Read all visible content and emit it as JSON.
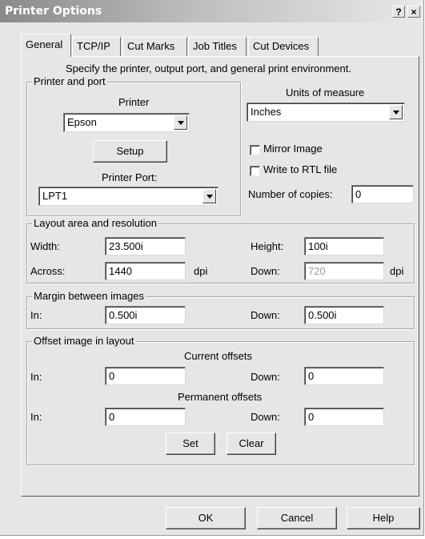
{
  "window": {
    "title": "Printer Options",
    "help_button": "?",
    "close_button": "×"
  },
  "tabs": [
    {
      "label": "General",
      "active": true
    },
    {
      "label": "TCP/IP",
      "active": false
    },
    {
      "label": "Cut Marks",
      "active": false
    },
    {
      "label": "Job Titles",
      "active": false
    },
    {
      "label": "Cut Devices",
      "active": false
    }
  ],
  "description": "Specify the printer, output port, and general print environment.",
  "printer_port": {
    "group_label": "Printer and port",
    "printer_label": "Printer",
    "printer_value": "Epson",
    "setup_label": "Setup",
    "port_label": "Printer Port:",
    "port_value": "LPT1"
  },
  "units": {
    "label": "Units of measure",
    "value": "Inches"
  },
  "options": {
    "mirror_label": "Mirror Image",
    "mirror_checked": false,
    "rtl_label": "Write to RTL file",
    "rtl_checked": false,
    "copies_label": "Number of copies:",
    "copies_value": "0"
  },
  "layout": {
    "group_label": "Layout area and resolution",
    "width_label": "Width:",
    "width_value": "23.500i",
    "height_label": "Height:",
    "height_value": "100i",
    "across_label": "Across:",
    "across_value": "1440",
    "dpi_label_1": "dpi",
    "down_label": "Down:",
    "down_value": "720",
    "dpi_label_2": "dpi"
  },
  "margin": {
    "group_label": "Margin between images",
    "in_label": "In:",
    "in_value": "0.500i",
    "down_label": "Down:",
    "down_value": "0.500i"
  },
  "offset": {
    "group_label": "Offset image in layout",
    "current_label": "Current offsets",
    "current_in_label": "In:",
    "current_in_value": "0",
    "current_down_label": "Down:",
    "current_down_value": "0",
    "permanent_label": "Permanent offsets",
    "permanent_in_label": "In:",
    "permanent_in_value": "0",
    "permanent_down_label": "Down:",
    "permanent_down_value": "0",
    "set_label": "Set",
    "clear_label": "Clear"
  },
  "footer": {
    "ok_label": "OK",
    "cancel_label": "Cancel",
    "help_label": "Help"
  }
}
